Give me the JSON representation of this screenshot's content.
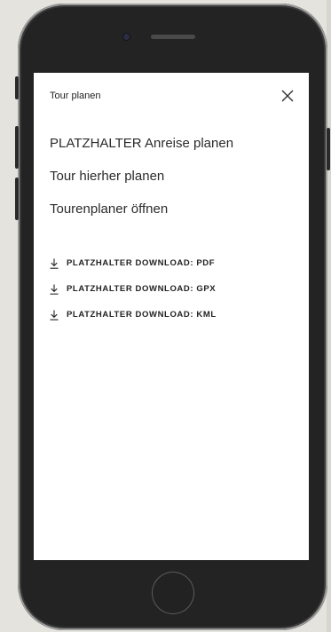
{
  "modal": {
    "title": "Tour planen",
    "close_icon": "close-icon"
  },
  "links": [
    "PLATZHALTER Anreise planen",
    "Tour hierher planen",
    "Tourenplaner öffnen"
  ],
  "downloads": [
    {
      "label": "PLATZHALTER DOWNLOAD: PDF",
      "icon": "download-icon"
    },
    {
      "label": "PLATZHALTER DOWNLOAD: GPX",
      "icon": "download-icon"
    },
    {
      "label": "PLATZHALTER DOWNLOAD: KML",
      "icon": "download-icon"
    }
  ],
  "colors": {
    "background": "#e4e3de",
    "phone_body": "#232323",
    "screen": "#ffffff",
    "text": "#2b2b2b"
  }
}
